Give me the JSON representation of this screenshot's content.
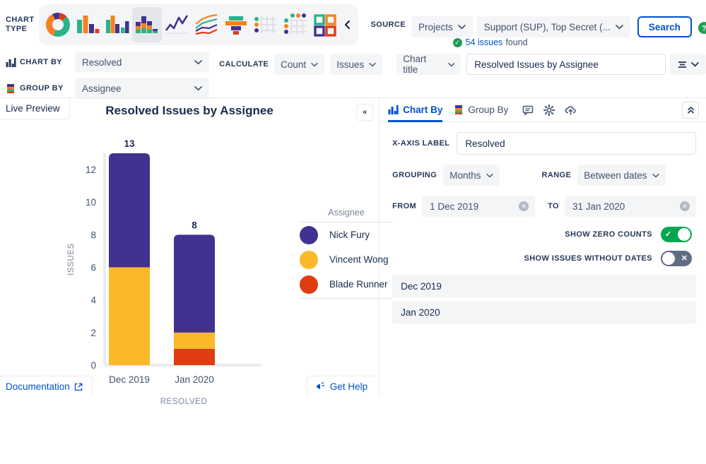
{
  "toolbar": {
    "chart_type_label": "CHART TYPE",
    "chart_types": [
      {
        "name": "donut-chart-type",
        "selected": false
      },
      {
        "name": "bar-chart-type",
        "selected": false
      },
      {
        "name": "grouped-bar-chart-type",
        "selected": false
      },
      {
        "name": "stacked-bar-chart-type",
        "selected": true
      },
      {
        "name": "line-chart-type",
        "selected": false
      },
      {
        "name": "multi-line-chart-type",
        "selected": false
      },
      {
        "name": "funnel-chart-type",
        "selected": false
      },
      {
        "name": "table-chart-type",
        "selected": false
      },
      {
        "name": "heatmap-chart-type",
        "selected": false
      },
      {
        "name": "tiles-chart-type",
        "selected": false
      }
    ],
    "collapse_icon": "chevron-left",
    "source_label": "SOURCE",
    "source_scope": "Projects",
    "source_projects": "Support (SUP), Top Secret (...",
    "search_label": "Search",
    "help_icon": "question-mark",
    "issues_found_count": "54 issues",
    "issues_found_suffix": "found"
  },
  "controls": {
    "chart_by_label": "CHART BY",
    "chart_by_value": "Resolved",
    "group_by_label": "GROUP BY",
    "group_by_value": "Assignee",
    "calculate_label": "CALCULATE",
    "calculate_func": "Count",
    "calculate_unit": "Issues",
    "chart_title_label": "Chart title",
    "chart_title_value": "Resolved Issues by Assignee",
    "align_icon": "align-menu-icon"
  },
  "preview": {
    "tab_label": "Live Preview",
    "heading": "Resolved Issues by Assignee",
    "collapse_icon": "chevron-double-left",
    "documentation_label": "Documentation",
    "documentation_icon": "external-link-icon",
    "get_help_label": "Get Help",
    "get_help_icon": "megaphone-icon"
  },
  "chart_data": {
    "type": "bar",
    "stacked": true,
    "title": "Resolved Issues by Assignee",
    "xlabel": "RESOLVED",
    "ylabel": "ISSUES",
    "categories": [
      "Dec 2019",
      "Jan 2020"
    ],
    "totals": [
      13,
      8
    ],
    "ylim": [
      0,
      13
    ],
    "yticks": [
      0,
      2,
      4,
      6,
      8,
      10,
      12
    ],
    "grid": false,
    "legend_title": "Assignee",
    "legend_position": "right",
    "series": [
      {
        "name": "Nick Fury",
        "color": "#433191",
        "values": [
          7,
          6
        ]
      },
      {
        "name": "Vincent Wong",
        "color": "#fbb829",
        "values": [
          6,
          1
        ]
      },
      {
        "name": "Blade Runner",
        "color": "#e03c12",
        "values": [
          0,
          1
        ]
      }
    ]
  },
  "panel": {
    "tab_chart_by": "Chart By",
    "tab_group_by": "Group By",
    "icon_comment": "comment-icon",
    "icon_settings": "gear-icon",
    "icon_upload": "cloud-upload-icon",
    "collapse_icon": "chevron-double-up",
    "x_axis_label_label": "X-AXIS LABEL",
    "x_axis_label_value": "Resolved",
    "grouping_label": "GROUPING",
    "grouping_value": "Months",
    "range_label": "RANGE",
    "range_value": "Between dates",
    "from_label": "FROM",
    "from_value": "1 Dec 2019",
    "to_label": "TO",
    "to_value": "31 Jan 2020",
    "show_zero_counts_label": "SHOW ZERO COUNTS",
    "show_zero_counts_state": "on",
    "show_issues_without_dates_label": "SHOW ISSUES WITHOUT DATES",
    "show_issues_without_dates_state": "off",
    "date_items": [
      "Dec 2019",
      "Jan 2020"
    ]
  },
  "colors": {
    "purple": "#433191",
    "yellow": "#fbb829",
    "red": "#e03c12",
    "green": "#2ab28a",
    "orange": "#f58220",
    "blue_link": "#0052cc"
  }
}
